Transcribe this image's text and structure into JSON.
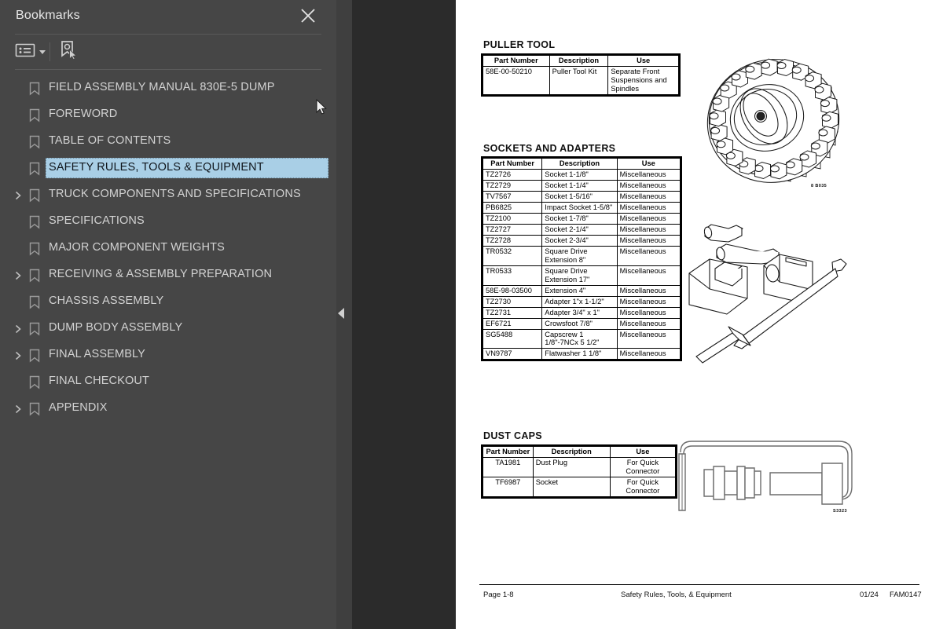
{
  "sidebar": {
    "title": "Bookmarks",
    "close_label": "Close",
    "toolbar": {
      "options_label": "Options",
      "find_label": "Find Bookmark"
    },
    "items": [
      {
        "label": "FIELD ASSEMBLY MANUAL 830E-5  DUMP",
        "expandable": false,
        "selected": false
      },
      {
        "label": "FOREWORD",
        "expandable": false,
        "selected": false
      },
      {
        "label": "TABLE OF CONTENTS",
        "expandable": false,
        "selected": false
      },
      {
        "label": "SAFETY RULES, TOOLS & EQUIPMENT",
        "expandable": false,
        "selected": true
      },
      {
        "label": "TRUCK COMPONENTS AND SPECIFICATIONS",
        "expandable": true,
        "selected": false
      },
      {
        "label": "SPECIFICATIONS",
        "expandable": false,
        "selected": false
      },
      {
        "label": "MAJOR COMPONENT WEIGHTS",
        "expandable": false,
        "selected": false
      },
      {
        "label": "RECEIVING & ASSEMBLY PREPARATION",
        "expandable": true,
        "selected": false
      },
      {
        "label": "CHASSIS ASSEMBLY",
        "expandable": false,
        "selected": false
      },
      {
        "label": "DUMP BODY ASSEMBLY",
        "expandable": true,
        "selected": false
      },
      {
        "label": "FINAL ASSEMBLY",
        "expandable": true,
        "selected": false
      },
      {
        "label": "FINAL CHECKOUT",
        "expandable": false,
        "selected": false
      },
      {
        "label": "APPENDIX",
        "expandable": true,
        "selected": false
      }
    ],
    "collapse_label": "Collapse panel"
  },
  "colors": {
    "panel_bg": "#464646",
    "splitter_bg": "#3f3f3f",
    "viewer_bg": "#2b2b2b",
    "page_bg": "#ffffff",
    "selection": "#a9cfe6",
    "label_text": "#d3d3d3"
  },
  "document": {
    "sections": [
      {
        "heading": "PULLER TOOL",
        "columns": [
          "Part Number",
          "Description",
          "Use"
        ],
        "rows": [
          [
            "58E-00-50210",
            "Puller Tool Kit",
            "Separate Front Suspensions and Spindles"
          ]
        ],
        "figure_code": "8 B035"
      },
      {
        "heading": "SOCKETS AND ADAPTERS",
        "columns": [
          "Part Number",
          "Description",
          "Use"
        ],
        "rows": [
          [
            "TZ2726",
            "Socket 1-1/8\"",
            "Miscellaneous"
          ],
          [
            "TZ2729",
            "Socket 1-1/4\"",
            "Miscellaneous"
          ],
          [
            "TV7567",
            "Socket 1-5/16\"",
            "Miscellaneous"
          ],
          [
            "PB6825",
            "Impact Socket 1-5/8\"",
            "Miscellaneous"
          ],
          [
            "TZ2100",
            "Socket 1-7/8\"",
            "Miscellaneous"
          ],
          [
            "TZ2727",
            "Socket 2-1/4\"",
            "Miscellaneous"
          ],
          [
            "TZ2728",
            "Socket 2-3/4\"",
            "Miscellaneous"
          ],
          [
            "TR0532",
            "Square Drive Extension 8\"",
            "Miscellaneous"
          ],
          [
            "TR0533",
            "Square Drive Extension 17\"",
            "Miscellaneous"
          ],
          [
            "58E-98-03500",
            "Extension 4\"",
            "Miscellaneous"
          ],
          [
            "TZ2730",
            "Adapter 1\"x 1-1/2\"",
            "Miscellaneous"
          ],
          [
            "TZ2731",
            "Adapter 3/4\" x 1\"",
            "Miscellaneous"
          ],
          [
            "EF6721",
            "Crowsfoot 7/8\"",
            "Miscellaneous"
          ],
          [
            "SG5488",
            "Capscrew 1 1/8\"-7NCx 5 1/2\"",
            "Miscellaneous"
          ],
          [
            "VN9787",
            "Flatwasher 1 1/8\"",
            "Miscellaneous"
          ]
        ]
      },
      {
        "heading": "DUST CAPS",
        "columns": [
          "Part Number",
          "Description",
          "Use"
        ],
        "rows": [
          [
            "TA1981",
            "Dust Plug",
            "For Quick Connector"
          ],
          [
            "TF6987",
            "Socket",
            "For Quick Connector"
          ]
        ],
        "figure_code": "S3323"
      }
    ],
    "footer": {
      "page": "Page 1-8",
      "title": "Safety Rules, Tools, & Equipment",
      "date": "01/24",
      "code": "FAM0147"
    }
  }
}
